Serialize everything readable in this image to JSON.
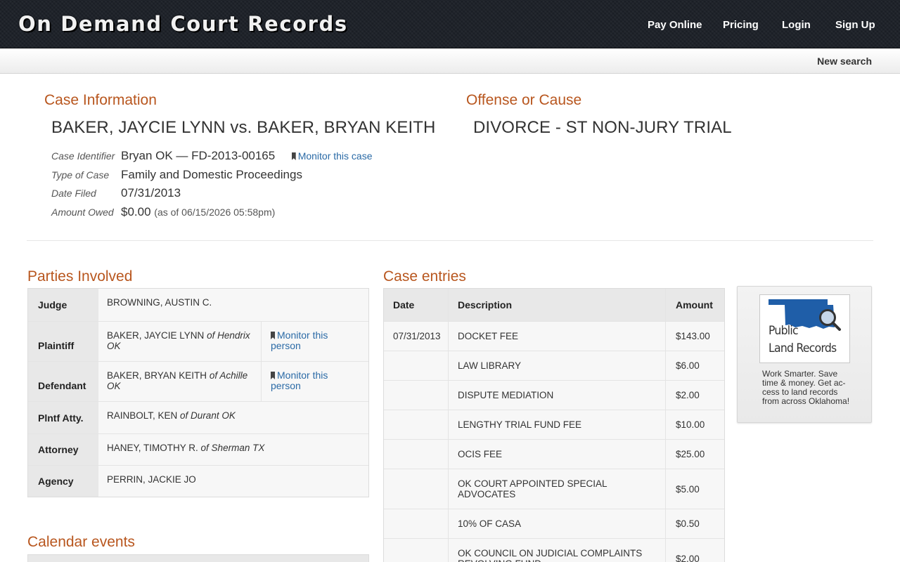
{
  "header": {
    "logo": "On Demand Court Records",
    "nav": [
      "Pay Online",
      "Pricing",
      "Login",
      "Sign Up"
    ],
    "new_search": "New search"
  },
  "case_info": {
    "heading": "Case Information",
    "title": "BAKER, JAYCIE LYNN vs. BAKER, BRYAN KEITH",
    "identifier_label": "Case Identifier",
    "identifier_value": "Bryan OK — FD-2013-00165",
    "monitor_case": "Monitor this case",
    "type_label": "Type of Case",
    "type_value": "Family and Domestic Proceedings",
    "filed_label": "Date Filed",
    "filed_value": "07/31/2013",
    "owed_label": "Amount Owed",
    "owed_value": "$0.00",
    "owed_asof": "(as of 06/15/2026 05:58pm)"
  },
  "offense": {
    "heading": "Offense or Cause",
    "title": "DIVORCE - ST NON-JURY TRIAL"
  },
  "parties": {
    "heading": "Parties Involved",
    "monitor_person": "Monitor this person",
    "rows": [
      {
        "role": "Judge",
        "name": "BROWNING, AUSTIN C.",
        "location": ""
      },
      {
        "role": "Plaintiff",
        "name": "BAKER, JAYCIE LYNN",
        "location": "of Hendrix OK"
      },
      {
        "role": "Defendant",
        "name": "BAKER, BRYAN KEITH",
        "location": "of Achille OK"
      },
      {
        "role": "Plntf Atty.",
        "name": "RAINBOLT, KEN",
        "location": "of Durant OK"
      },
      {
        "role": "Attorney",
        "name": "HANEY, TIMOTHY R.",
        "location": "of Sherman TX"
      },
      {
        "role": "Agency",
        "name": "PERRIN, JACKIE JO",
        "location": ""
      }
    ]
  },
  "entries": {
    "heading": "Case entries",
    "columns": [
      "Date",
      "Description",
      "Amount"
    ],
    "rows": [
      {
        "date": "07/31/2013",
        "desc": "DOCKET FEE",
        "amount": "$143.00"
      },
      {
        "date": "",
        "desc": "LAW LIBRARY",
        "amount": "$6.00"
      },
      {
        "date": "",
        "desc": "DISPUTE MEDIATION",
        "amount": "$2.00"
      },
      {
        "date": "",
        "desc": "LENGTHY TRIAL FUND FEE",
        "amount": "$10.00"
      },
      {
        "date": "",
        "desc": "OCIS FEE",
        "amount": "$25.00"
      },
      {
        "date": "",
        "desc": "OK COURT APPOINTED SPECIAL ADVOCATES",
        "amount": "$5.00"
      },
      {
        "date": "",
        "desc": "10% OF CASA",
        "amount": "$0.50"
      },
      {
        "date": "",
        "desc": "OK COUNCIL ON JUDICIAL COMPLAINTS REVOLVING FUND",
        "amount": "$2.00"
      }
    ]
  },
  "ad": {
    "logo_line1": "Public",
    "logo_line2": "Land Records",
    "text": "Work Smarter. Save time & money. Get ac-cess to land records from across Oklahoma!",
    "state_color": "#1f5ea8"
  },
  "calendar": {
    "heading": "Calendar events"
  }
}
